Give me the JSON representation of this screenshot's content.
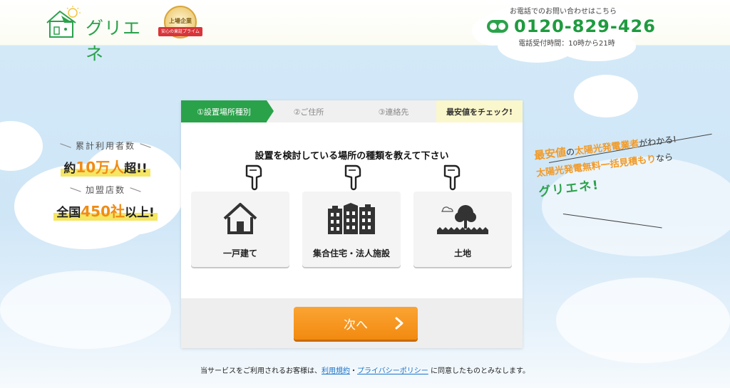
{
  "header": {
    "logo_text": "グリエネ",
    "badge_top": "上場企業",
    "badge_ribbon": "安心の東証プライム",
    "phone_caption": "お電話でのお問い合わせはこちら",
    "phone_number": "0120-829-426",
    "phone_hours": "電話受付時間：10時から21時"
  },
  "stats": {
    "users_label": "累計利用者数",
    "users_prefix": "約",
    "users_num": "10万人",
    "users_suffix": "超!!",
    "stores_label": "加盟店数",
    "stores_prefix": "全国",
    "stores_num": "450社",
    "stores_suffix": "以上!"
  },
  "right_copy": {
    "line1_a": "最安値",
    "line1_b": "の",
    "line1_c": "太陽光発電業者",
    "line1_d": "がわかる!",
    "line2_a": "太陽光発電無料一括見積もり",
    "line2_b": "なら",
    "line3": "グリエネ!"
  },
  "steps": {
    "step1": "①設置場所種別",
    "step2": "②ご住所",
    "step3": "③連絡先",
    "step4": "最安値をチェック!"
  },
  "form": {
    "question": "設置を検討している場所の種類を教えて下さい",
    "options": [
      {
        "label": "一戸建て"
      },
      {
        "label": "集合住宅・法人施設"
      },
      {
        "label": "土地"
      }
    ],
    "next_label": "次へ"
  },
  "footer": {
    "agree_prefix": "当サービスをご利用されるお客様は、",
    "terms_link": "利用規約",
    "separator": "・",
    "privacy_link": "プライバシーポリシー",
    "agree_suffix": " に同意したものとみなします。"
  },
  "colors": {
    "brand_green": "#2aa24a",
    "accent_orange": "#f28a10",
    "highlight_yellow": "#f5e663"
  }
}
